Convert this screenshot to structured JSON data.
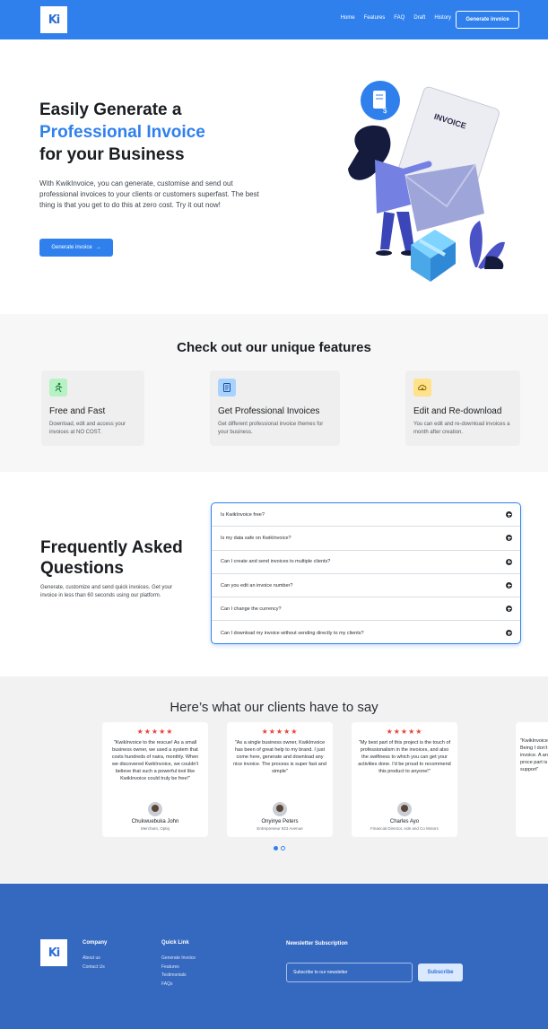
{
  "nav": {
    "logo_text": "Ki",
    "links": [
      "Home",
      "Features",
      "FAQ",
      "Draft",
      "History"
    ],
    "cta_label": "Generate invoice",
    "bg_color": "#2f80ed"
  },
  "hero": {
    "title_line1": "Easily Generate a",
    "title_highlight": "Professional Invoice",
    "title_line3": "for your Business",
    "description": "With KwikInvoice, you can generate, customise and send out professional invoices to your clients or customers superfast. The best thing is that you get to do this at zero cost. Try it out now!",
    "cta_label": "Generate invoice",
    "cta_arrow": "→",
    "illustration_text": "INVOICE",
    "illustration_icon": "invoice-dollar-icon"
  },
  "features": {
    "title": "Check out our unique features",
    "items": [
      {
        "icon": "running-person-icon",
        "title": "Free and Fast",
        "description": "Download, edit and access your invoices at NO COST.",
        "icon_bg": "#b6f2c4"
      },
      {
        "icon": "document-icon",
        "title": "Get Professional Invoices",
        "description": "Get different professional invoice themes for your business.",
        "icon_bg": "#a8d2ff"
      },
      {
        "icon": "cloud-download-icon",
        "title": "Edit and Re-download",
        "description": "You can edit and re-download invoices a month after creation.",
        "icon_bg": "#ffe28a"
      }
    ]
  },
  "faq": {
    "title": "Frequently Asked Questions",
    "description": "Generate, customize and send quick invoices. Get your invoice in less than 60 seconds using our platform.",
    "items": [
      "Is KwikInvoice free?",
      "Is my data safe on KwikInvoice?",
      "Can I create and send invoices to multiple clients?",
      "Can you edit an invoice number?",
      "Can I change the currency?",
      "Can I download my invoice without sending directly to my clients?"
    ]
  },
  "testimonials": {
    "title": "Here’s what our clients have to say",
    "stars": "★★★★★",
    "items": [
      {
        "quote": "\"KwikInvoice to the rescue! As a small business owner, we used a system that costs hundreds of naira, monthly. When we discovered KwikInvoice, we couldn't believe that such a powerful tool like KwikInvoice could truly be free!\"",
        "name": "Chukwuebuka John",
        "role": "Merchant, Optiq"
      },
      {
        "quote": "\"As a single business owner, KwikInvoice has been of great help to my brand. I just come here, generate and download any nice invoice. The process is super fast and simple\"",
        "name": "Onyinye Peters",
        "role": "Entrepreneur 823 Avenue"
      },
      {
        "quote": "\"My best part of this project is the touch of professionalism in the invoices, and also the swiftness to which you can get your activities done. I'd be proud to recommend this product to anyone!\"",
        "name": "Charles Ayo",
        "role": "Financial Director, Ade and Co Motors"
      },
      {
        "quote": "\"KwikInvoice Being I don't h invoice. A and proce part is the support\"",
        "name": "",
        "role": ""
      }
    ],
    "active_page": 1,
    "page_count": 2
  },
  "footer": {
    "logo_text": "Ki",
    "company_title": "Company",
    "company_links": [
      "About us",
      "Contact Us"
    ],
    "quick_title": "Quick Link",
    "quick_links": [
      "Generate Invoice",
      "Features",
      "Testimonials",
      "FAQs"
    ],
    "newsletter_title": "Newsletter Subscription",
    "newsletter_placeholder": "Subscribe to our newsletter",
    "subscribe_label": "Subscribe",
    "bg_color": "#3568bf"
  }
}
